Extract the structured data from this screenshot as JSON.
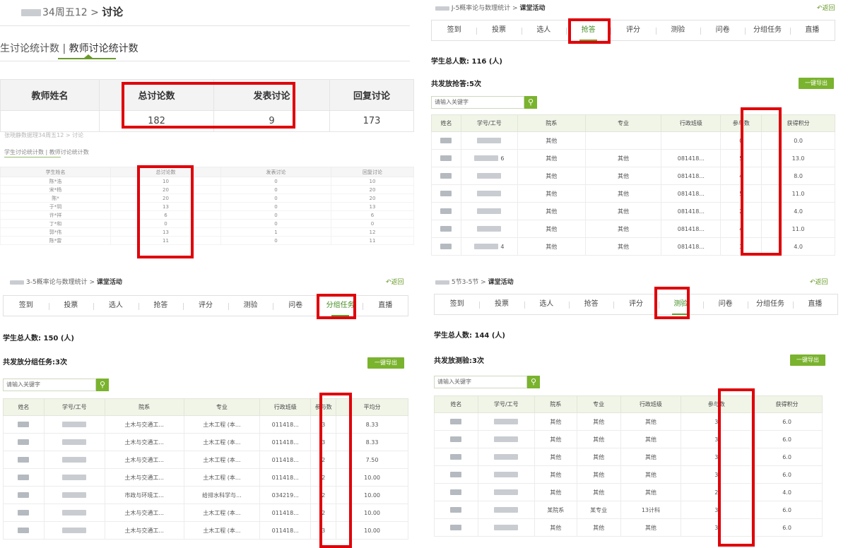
{
  "q1": {
    "breadcrumb_prefix": "34周五12 > ",
    "breadcrumb_title": "讨论",
    "tab_student": "生讨论统计数",
    "tab_sep": " | ",
    "tab_teacher": "教师讨论统计数",
    "headers": [
      "教师姓名",
      "总讨论数",
      "发表讨论",
      "回复讨论"
    ],
    "row": [
      "",
      "182",
      "9",
      "173"
    ],
    "ghost": {
      "breadcrumb": "张晓静数据理34周五12 > 讨论",
      "tab_student": "学生讨论统计数",
      "tab_sep": " | ",
      "tab_teacher": "教师讨论统计数",
      "headers": [
        "学生姓名",
        "总讨论数",
        "发表讨论",
        "回复讨论"
      ],
      "rows": [
        [
          "陈*浩",
          "10",
          "0",
          "10"
        ],
        [
          "宋*杨",
          "20",
          "0",
          "20"
        ],
        [
          "陈*",
          "20",
          "0",
          "20"
        ],
        [
          "于*玥",
          "13",
          "0",
          "13"
        ],
        [
          "许*祥",
          "6",
          "0",
          "6"
        ],
        [
          "丁*和",
          "0",
          "0",
          "0"
        ],
        [
          "郭*伟",
          "13",
          "1",
          "12"
        ],
        [
          "陈*雷",
          "11",
          "0",
          "11"
        ]
      ]
    }
  },
  "q2": {
    "breadcrumb": "J-5概率论与数理统计",
    "breadcrumb_current": "课堂活动",
    "back": "返回",
    "nav": [
      "签到",
      "投票",
      "选人",
      "抢答",
      "评分",
      "测验",
      "问卷",
      "分组任务",
      "直播"
    ],
    "total": "学生总人数: 116 (人)",
    "count": "共发放抢答:5次",
    "export": "一键导出",
    "search_placeholder": "请输入关键字",
    "headers": [
      "姓名",
      "学号/工号",
      "院系",
      "专业",
      "行政班级",
      "参与数",
      "获得积分"
    ],
    "rows": [
      [
        "",
        "",
        "其他",
        "",
        "",
        "0",
        "0.0"
      ],
      [
        "",
        "6",
        "其他",
        "其他",
        "081418...",
        "5",
        "13.0"
      ],
      [
        "",
        "",
        "其他",
        "其他",
        "081418...",
        "4",
        "8.0"
      ],
      [
        "",
        "",
        "其他",
        "其他",
        "081418...",
        "5",
        "11.0"
      ],
      [
        "",
        "",
        "其他",
        "其他",
        "081418...",
        "2",
        "4.0"
      ],
      [
        "",
        "",
        "其他",
        "其他",
        "081418...",
        "4",
        "11.0"
      ],
      [
        "",
        "4",
        "其他",
        "其他",
        "081418...",
        "3",
        "4.0"
      ]
    ]
  },
  "q3": {
    "breadcrumb": "3-5概率论与数理统计",
    "breadcrumb_current": "课堂活动",
    "back": "返回",
    "nav": [
      "签到",
      "投票",
      "选人",
      "抢答",
      "评分",
      "测验",
      "问卷",
      "分组任务",
      "直播"
    ],
    "total": "学生总人数: 150 (人)",
    "count": "共发放分组任务:3次",
    "export": "一键导出",
    "search_placeholder": "请输入关键字",
    "headers": [
      "姓名",
      "学号/工号",
      "院系",
      "专业",
      "行政班级",
      "参与数",
      "平均分"
    ],
    "rows": [
      [
        "",
        "",
        "土木与交通工...",
        "土木工程 (本...",
        "011418...",
        "3",
        "8.33"
      ],
      [
        "",
        "",
        "土木与交通工...",
        "土木工程 (本...",
        "011418...",
        "3",
        "8.33"
      ],
      [
        "",
        "",
        "土木与交通工...",
        "土木工程 (本...",
        "011418...",
        "2",
        "7.50"
      ],
      [
        "",
        "",
        "土木与交通工...",
        "土木工程 (本...",
        "011418...",
        "2",
        "10.00"
      ],
      [
        "",
        "",
        "市政与环境工...",
        "给排水科学与...",
        "034219...",
        "2",
        "10.00"
      ],
      [
        "",
        "",
        "土木与交通工...",
        "土木工程 (本...",
        "011418...",
        "2",
        "10.00"
      ],
      [
        "",
        "",
        "土木与交通工...",
        "土木工程 (本...",
        "011418...",
        "3",
        "10.00"
      ]
    ]
  },
  "q4": {
    "breadcrumb": "5节3-5节",
    "breadcrumb_current": "课堂活动",
    "back": "返回",
    "nav": [
      "签到",
      "投票",
      "选人",
      "抢答",
      "评分",
      "测验",
      "问卷",
      "分组任务",
      "直播"
    ],
    "total": "学生总人数: 144 (人)",
    "count": "共发放测验:3次",
    "export": "一键导出",
    "search_placeholder": "请输入关键字",
    "headers": [
      "姓名",
      "学号/工号",
      "院系",
      "专业",
      "行政班级",
      "参与数",
      "获得积分"
    ],
    "rows": [
      [
        "",
        "",
        "其他",
        "其他",
        "其他",
        "3",
        "6.0"
      ],
      [
        "",
        "",
        "其他",
        "其他",
        "其他",
        "3",
        "6.0"
      ],
      [
        "",
        "",
        "其他",
        "其他",
        "其他",
        "3",
        "6.0"
      ],
      [
        "",
        "",
        "其他",
        "其他",
        "其他",
        "3",
        "6.0"
      ],
      [
        "",
        "",
        "其他",
        "其他",
        "其他",
        "2",
        "4.0"
      ],
      [
        "",
        "",
        "某院系",
        "某专业",
        "13计科",
        "3",
        "6.0"
      ],
      [
        "",
        "",
        "其他",
        "其他",
        "其他",
        "3",
        "6.0"
      ]
    ]
  },
  "accent_color": "#6a9b2a",
  "highlight_color": "#e0000a"
}
